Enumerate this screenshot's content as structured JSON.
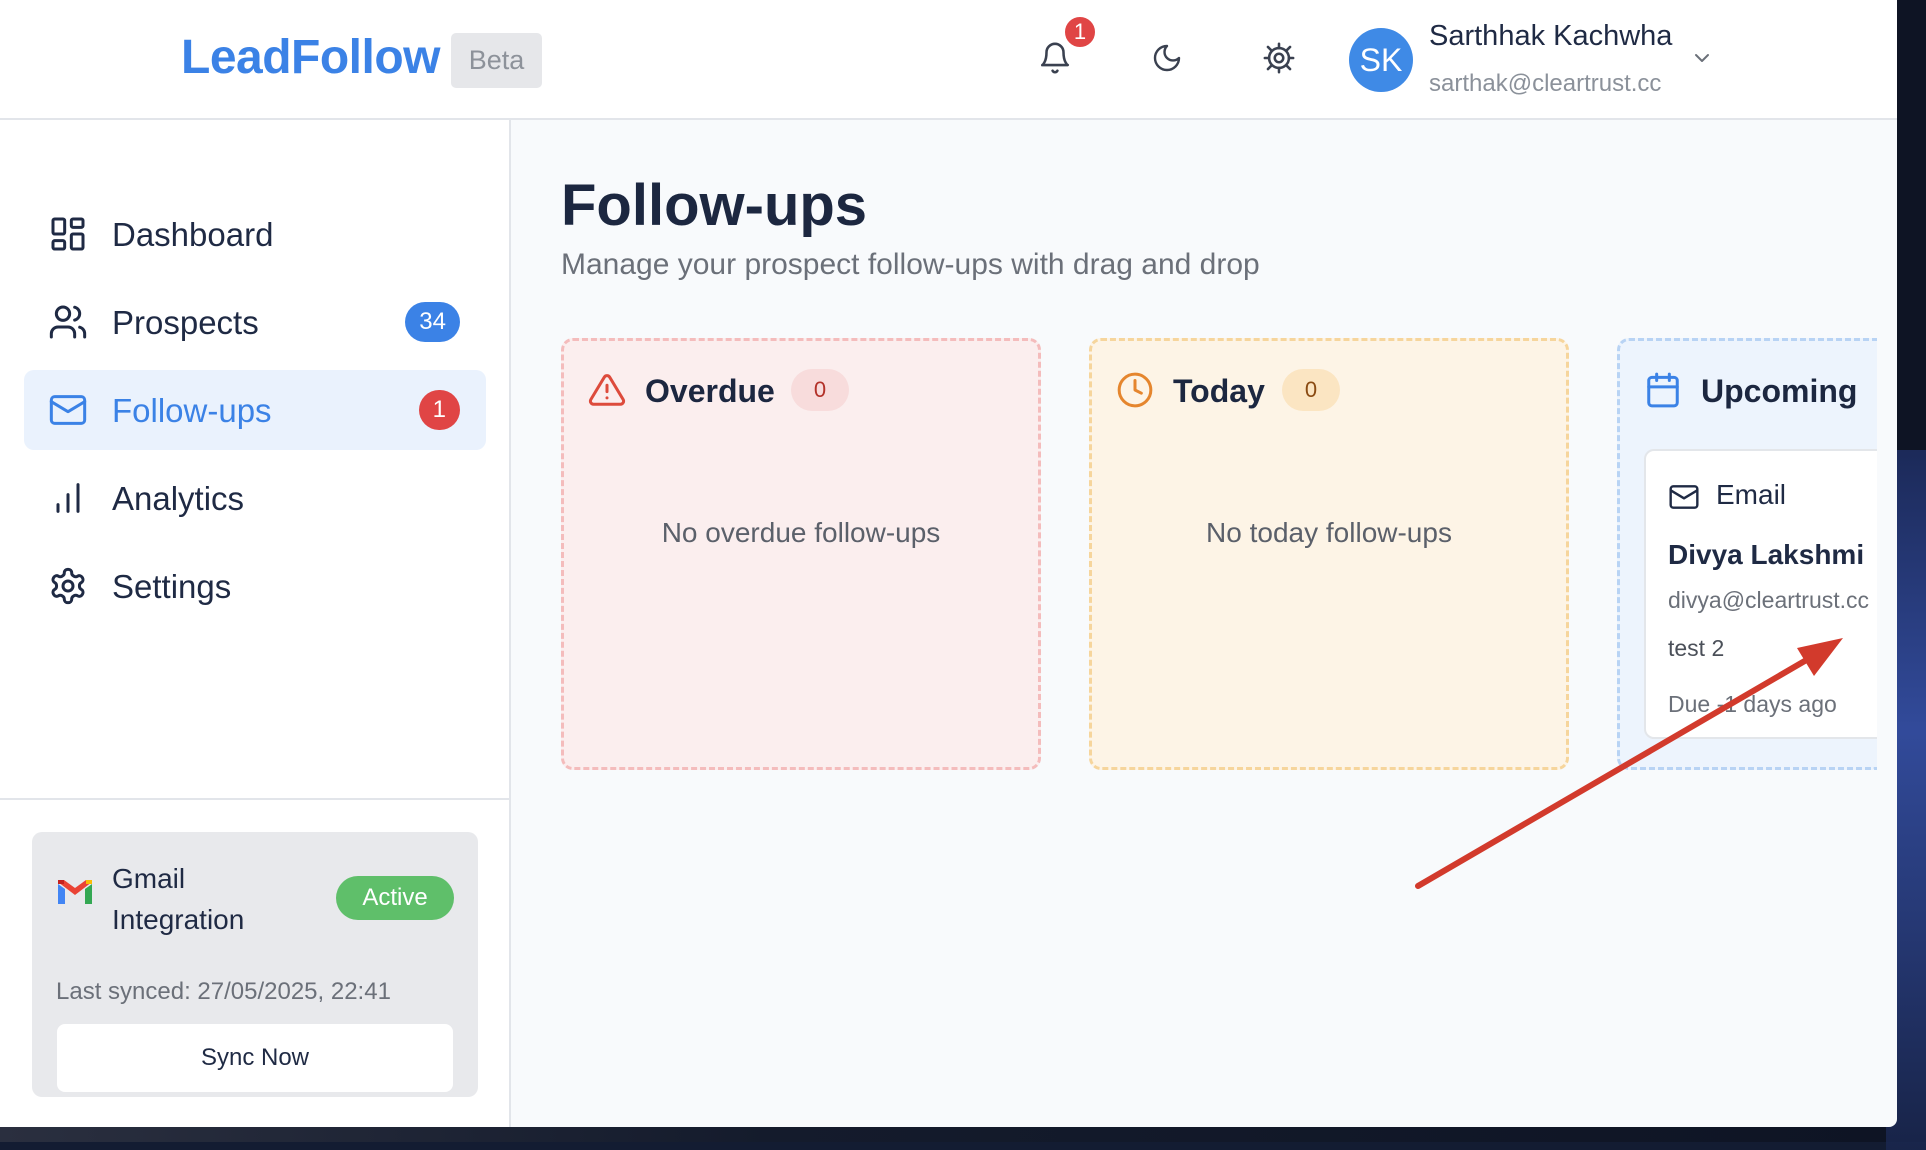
{
  "header": {
    "logo": "LeadFollow",
    "beta": "Beta",
    "notification_count": "1",
    "user": {
      "initials": "SK",
      "name": "Sarthhak Kachwha",
      "email": "sarthak@cleartrust.cc"
    }
  },
  "sidebar": {
    "items": [
      {
        "label": "Dashboard",
        "icon": "dashboard-icon"
      },
      {
        "label": "Prospects",
        "icon": "users-icon",
        "badge": "34"
      },
      {
        "label": "Follow-ups",
        "icon": "mail-icon",
        "badge": "1",
        "active": true
      },
      {
        "label": "Analytics",
        "icon": "bar-chart-icon"
      },
      {
        "label": "Settings",
        "icon": "gear-icon"
      }
    ],
    "gmail": {
      "title": "Gmail Integration",
      "status": "Active",
      "last_synced": "Last synced: 27/05/2025, 22:41",
      "sync_button": "Sync Now"
    }
  },
  "main": {
    "title": "Follow-ups",
    "subtitle": "Manage your prospect follow-ups with drag and drop",
    "columns": [
      {
        "label": "Overdue",
        "count": "0",
        "empty": "No overdue follow-ups"
      },
      {
        "label": "Today",
        "count": "0",
        "empty": "No today follow-ups"
      },
      {
        "label": "Upcoming",
        "card": {
          "type": "Email",
          "name": "Divya Lakshmi",
          "email": "divya@cleartrust.cc",
          "note": "test 2",
          "due": "Due -1 days ago"
        }
      }
    ]
  },
  "colors": {
    "accent": "#3b82e6",
    "danger": "#e04545",
    "success": "#5fbf6a",
    "annotation_arrow": "#d23a2c"
  }
}
